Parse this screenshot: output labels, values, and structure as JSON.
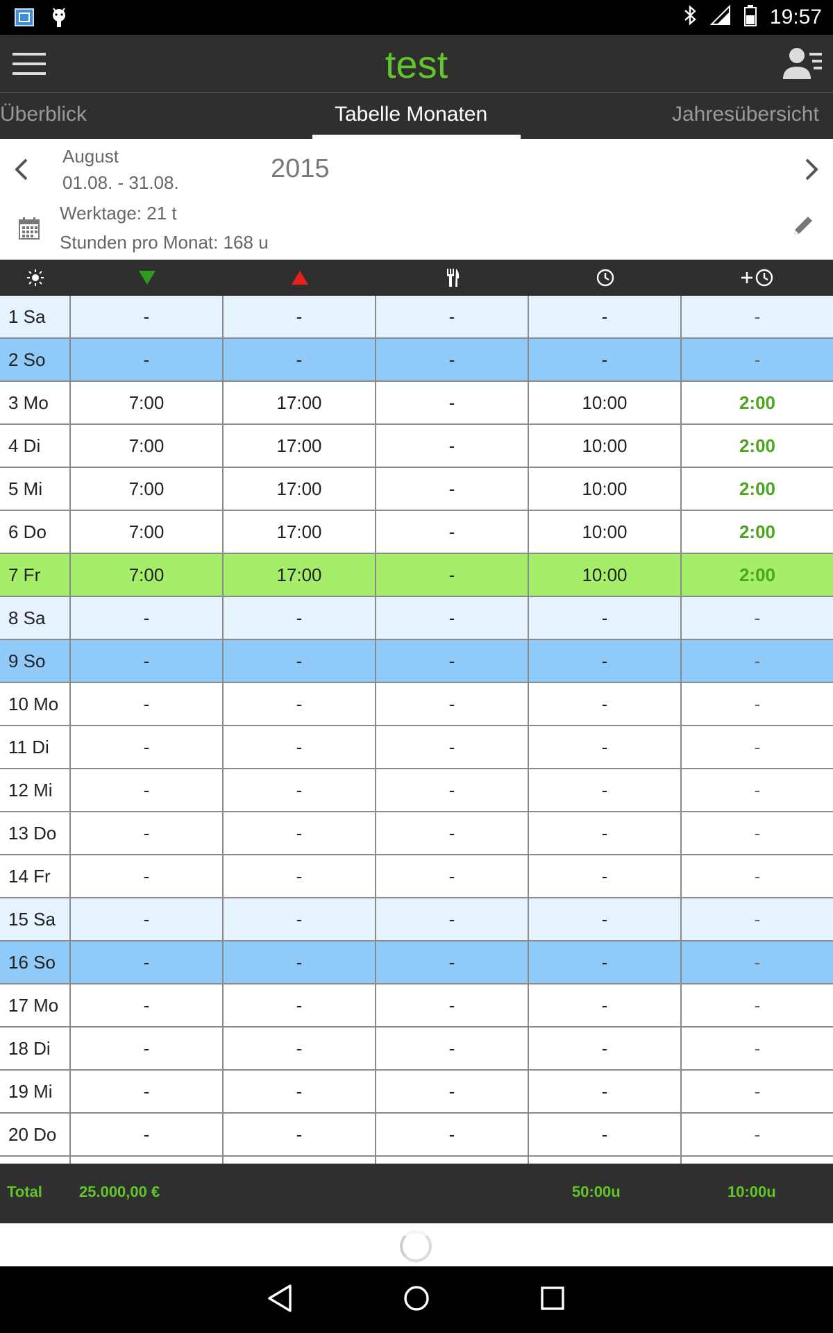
{
  "status_bar": {
    "time": "19:57",
    "icons": [
      "app-icon",
      "android-icon",
      "bluetooth-icon",
      "signal-icon",
      "battery-icon"
    ]
  },
  "toolbar": {
    "title": "test",
    "menu_icon": "hamburger-menu-icon",
    "profile_icon": "person-list-icon"
  },
  "tabs": [
    {
      "label": "Überblick",
      "active": false
    },
    {
      "label": "Tabelle Monaten",
      "active": true
    },
    {
      "label": "Jahresübersicht",
      "active": false
    }
  ],
  "period": {
    "month": "August",
    "range": "01.08. - 31.08.",
    "year": "2015",
    "workdays": "Werktage:  21 t",
    "hours_per_month": "Stunden pro Monat:  168 u"
  },
  "columns": [
    {
      "icon": "sun-icon"
    },
    {
      "icon": "arrow-down-green-icon"
    },
    {
      "icon": "arrow-up-red-icon"
    },
    {
      "icon": "cutlery-icon"
    },
    {
      "icon": "clock-icon"
    },
    {
      "icon": "plus-clock-icon"
    }
  ],
  "rows": [
    {
      "day": "1 Sa",
      "type": "sat",
      "start": "-",
      "end": "-",
      "break": "-",
      "hours": "-",
      "overtime": "-"
    },
    {
      "day": "2 So",
      "type": "sun",
      "start": "-",
      "end": "-",
      "break": "-",
      "hours": "-",
      "overtime": "-"
    },
    {
      "day": "3 Mo",
      "type": "work",
      "start": "7:00",
      "end": "17:00",
      "break": "-",
      "hours": "10:00",
      "overtime": "2:00"
    },
    {
      "day": "4 Di",
      "type": "work",
      "start": "7:00",
      "end": "17:00",
      "break": "-",
      "hours": "10:00",
      "overtime": "2:00"
    },
    {
      "day": "5 Mi",
      "type": "work",
      "start": "7:00",
      "end": "17:00",
      "break": "-",
      "hours": "10:00",
      "overtime": "2:00"
    },
    {
      "day": "6 Do",
      "type": "work",
      "start": "7:00",
      "end": "17:00",
      "break": "-",
      "hours": "10:00",
      "overtime": "2:00"
    },
    {
      "day": "7 Fr",
      "type": "today",
      "start": "7:00",
      "end": "17:00",
      "break": "-",
      "hours": "10:00",
      "overtime": "2:00"
    },
    {
      "day": "8 Sa",
      "type": "sat",
      "start": "-",
      "end": "-",
      "break": "-",
      "hours": "-",
      "overtime": "-"
    },
    {
      "day": "9 So",
      "type": "sun",
      "start": "-",
      "end": "-",
      "break": "-",
      "hours": "-",
      "overtime": "-"
    },
    {
      "day": "10 Mo",
      "type": "work",
      "start": "-",
      "end": "-",
      "break": "-",
      "hours": "-",
      "overtime": "-"
    },
    {
      "day": "11 Di",
      "type": "work",
      "start": "-",
      "end": "-",
      "break": "-",
      "hours": "-",
      "overtime": "-"
    },
    {
      "day": "12 Mi",
      "type": "work",
      "start": "-",
      "end": "-",
      "break": "-",
      "hours": "-",
      "overtime": "-"
    },
    {
      "day": "13 Do",
      "type": "work",
      "start": "-",
      "end": "-",
      "break": "-",
      "hours": "-",
      "overtime": "-"
    },
    {
      "day": "14 Fr",
      "type": "work",
      "start": "-",
      "end": "-",
      "break": "-",
      "hours": "-",
      "overtime": "-"
    },
    {
      "day": "15 Sa",
      "type": "sat",
      "start": "-",
      "end": "-",
      "break": "-",
      "hours": "-",
      "overtime": "-"
    },
    {
      "day": "16 So",
      "type": "sun",
      "start": "-",
      "end": "-",
      "break": "-",
      "hours": "-",
      "overtime": "-"
    },
    {
      "day": "17 Mo",
      "type": "work",
      "start": "-",
      "end": "-",
      "break": "-",
      "hours": "-",
      "overtime": "-"
    },
    {
      "day": "18 Di",
      "type": "work",
      "start": "-",
      "end": "-",
      "break": "-",
      "hours": "-",
      "overtime": "-"
    },
    {
      "day": "19 Mi",
      "type": "work",
      "start": "-",
      "end": "-",
      "break": "-",
      "hours": "-",
      "overtime": "-"
    },
    {
      "day": "20 Do",
      "type": "work",
      "start": "-",
      "end": "-",
      "break": "-",
      "hours": "-",
      "overtime": "-"
    }
  ],
  "totals": {
    "label": "Total",
    "amount": "25.000,00 €",
    "hours": "50:00u",
    "overtime": "10:00u"
  },
  "colors": {
    "accent_green": "#62c62a",
    "overtime_green": "#4ca51f",
    "today_row": "#a6ed6a",
    "sunday_row": "#90caf9",
    "saturday_row": "#e6f3fe",
    "toolbar_bg": "#2f2f2f"
  },
  "navbar": [
    "back-icon",
    "home-icon",
    "recents-icon"
  ]
}
